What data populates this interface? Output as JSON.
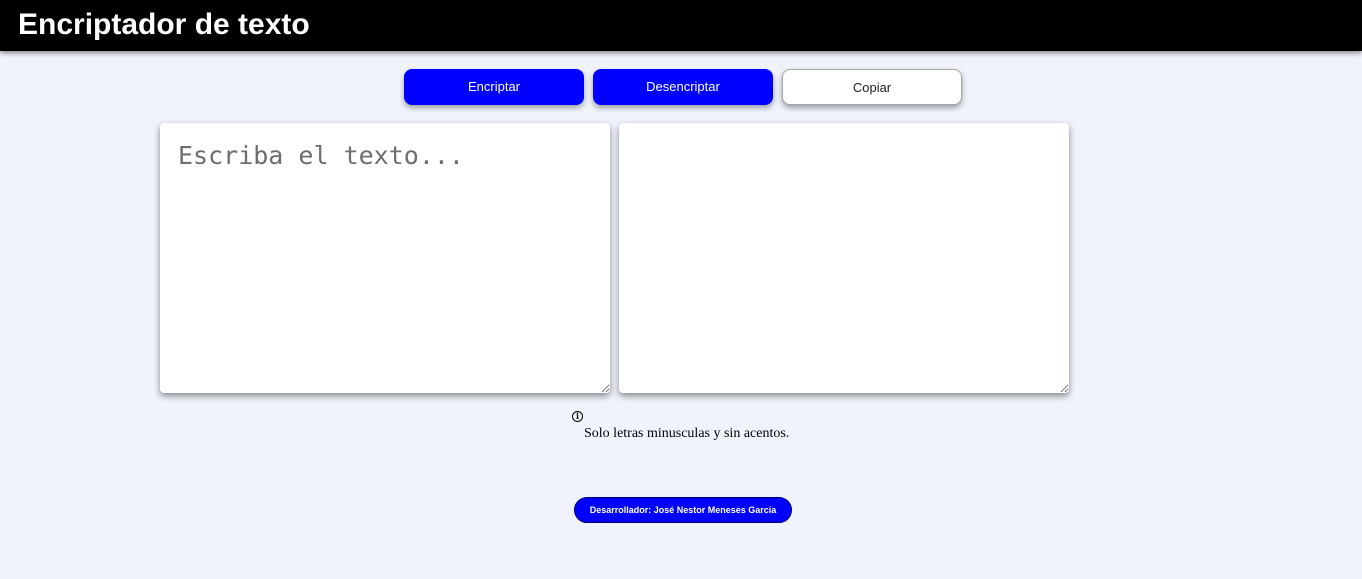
{
  "header": {
    "title": "Encriptador de texto"
  },
  "toolbar": {
    "encrypt_label": "Encriptar",
    "decrypt_label": "Desencriptar",
    "copy_label": "Copiar"
  },
  "input": {
    "placeholder": "Escriba el texto...",
    "value": ""
  },
  "output": {
    "value": ""
  },
  "hint": {
    "icon": "info-icon",
    "icon_glyph": "i",
    "text": "Solo letras minusculas y sin acentos."
  },
  "footer": {
    "developer": "Desarrollador: José Nestor Meneses García"
  },
  "colors": {
    "header_bg": "#000000",
    "accent": "#0000ff",
    "page_bg": "#f0f3fc"
  }
}
